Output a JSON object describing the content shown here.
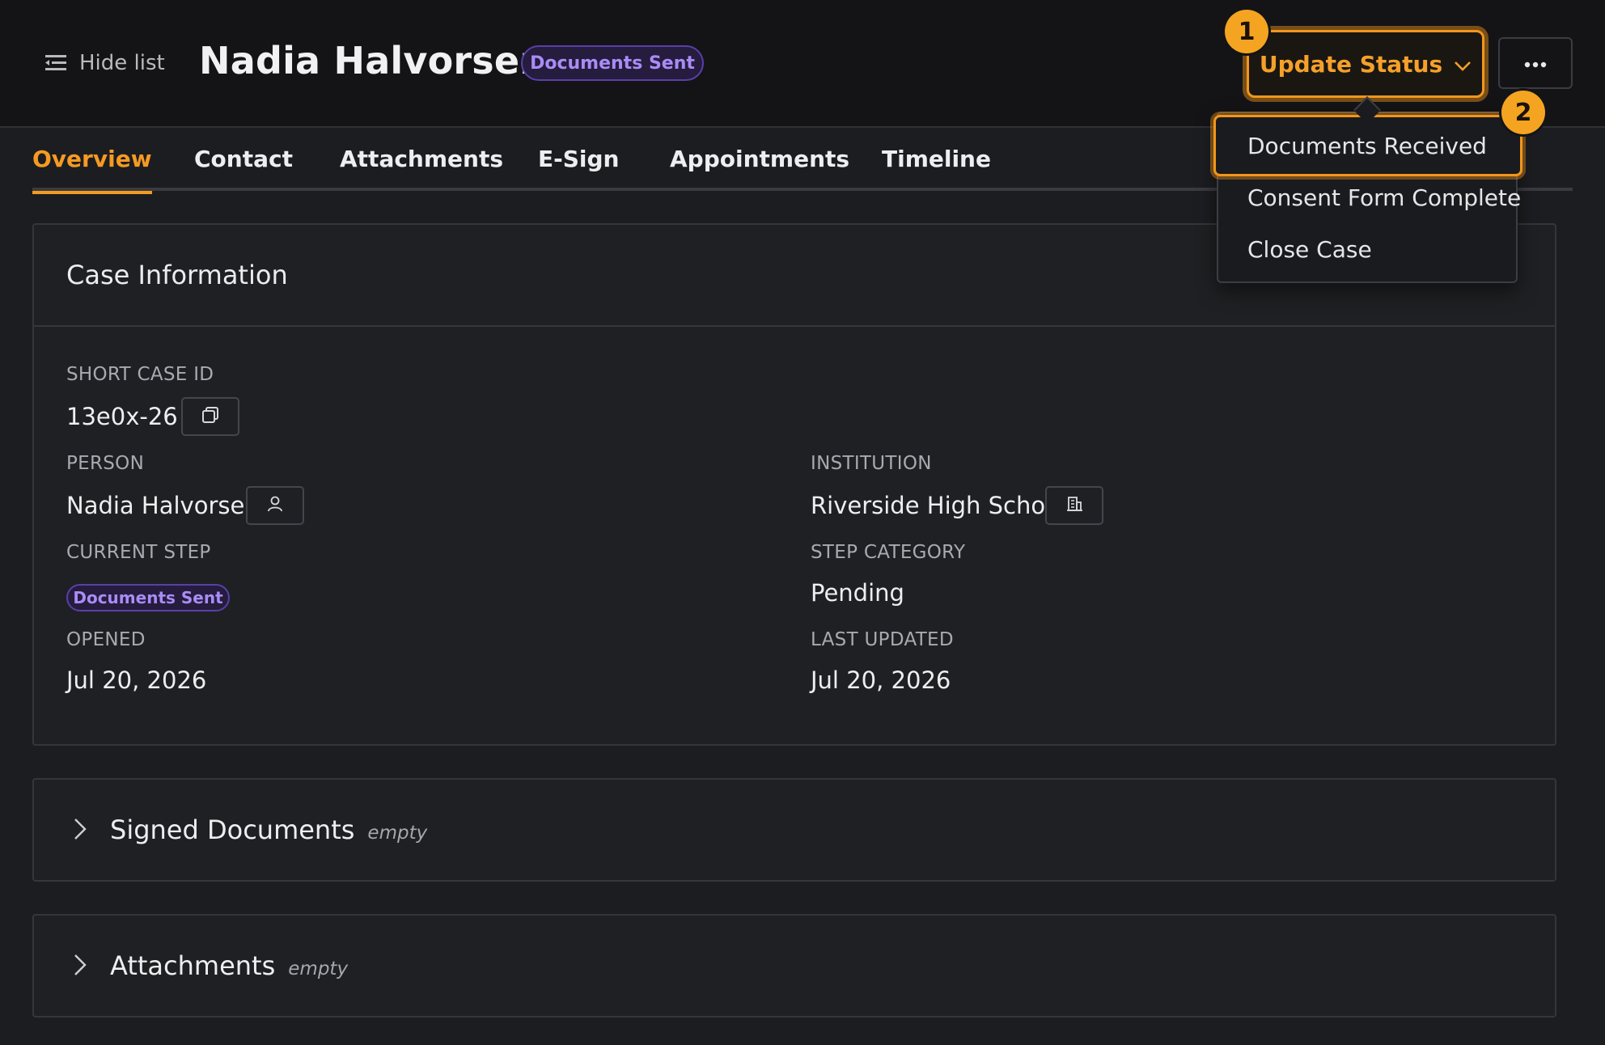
{
  "header": {
    "hide_list_label": "Hide list",
    "person_name": "Nadia Halvorsen",
    "status_pill": "Documents Sent",
    "update_status_label": "Update Status",
    "more_label": "···"
  },
  "annotations": {
    "badge_1": "1",
    "badge_2": "2"
  },
  "tabs": [
    {
      "label": "Overview",
      "active": true
    },
    {
      "label": "Contact"
    },
    {
      "label": "Attachments"
    },
    {
      "label": "E-Sign"
    },
    {
      "label": "Appointments"
    },
    {
      "label": "Timeline"
    }
  ],
  "status_menu": {
    "items": [
      "Documents Received",
      "Consent Form Complete",
      "Close Case"
    ],
    "highlighted_index": 0
  },
  "case_info": {
    "title": "Case Information",
    "short_case_id_label": "SHORT CASE ID",
    "short_case_id": "13e0x-26",
    "person_label": "PERSON",
    "person": "Nadia Halvorsen",
    "institution_label": "INSTITUTION",
    "institution": "Riverside High School",
    "current_step_label": "CURRENT STEP",
    "current_step": "Documents Sent",
    "step_category_label": "STEP CATEGORY",
    "step_category": "Pending",
    "opened_label": "OPENED",
    "opened": "Jul 20, 2026",
    "last_updated_label": "LAST UPDATED",
    "last_updated": "Jul 20, 2026"
  },
  "sections": [
    {
      "title": "Signed Documents",
      "tag": "empty"
    },
    {
      "title": "Attachments",
      "tag": "empty"
    }
  ],
  "colors": {
    "accent": "#f59a23",
    "pill_text": "#a98cf5",
    "background": "#1c1d20"
  },
  "icons": {
    "hide_list": "list-icon",
    "dropdown": "chevron-down-icon",
    "more": "ellipsis-icon",
    "copy": "copy-icon",
    "person": "user-icon",
    "institution": "building-icon",
    "expand": "chevron-right-icon"
  }
}
